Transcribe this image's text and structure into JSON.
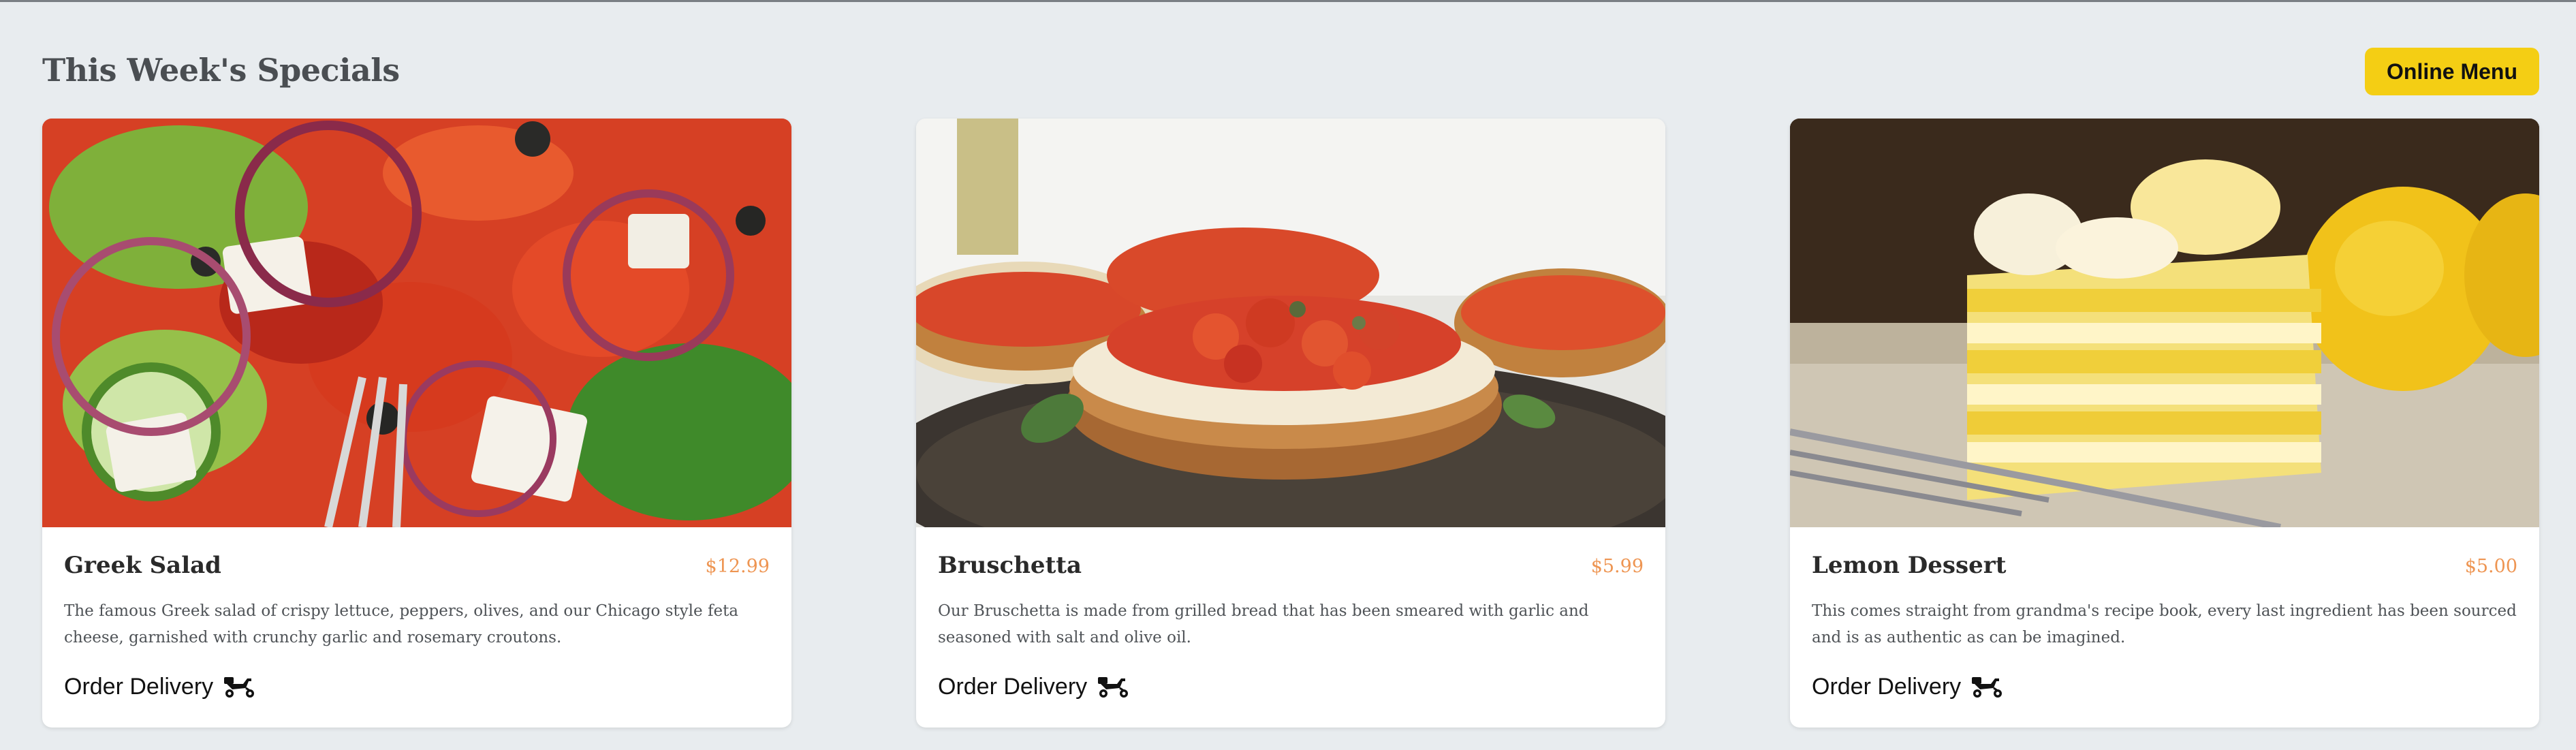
{
  "header": {
    "title": "This Week's Specials",
    "menu_button": "Online Menu"
  },
  "colors": {
    "background": "#e8ecef",
    "accent": "#f4ce14",
    "price": "#ee9552"
  },
  "cards": [
    {
      "name": "Greek Salad",
      "price": "$12.99",
      "description": "The famous Greek salad of crispy lettuce, peppers, olives, and our Chicago style feta cheese, garnished with crunchy garlic and rosemary croutons.",
      "order_label": "Order Delivery",
      "order_icon": "delivery-scooter-icon"
    },
    {
      "name": "Bruschetta",
      "price": "$5.99",
      "description": "Our Bruschetta is made from grilled bread that has been smeared with garlic and seasoned with salt and olive oil.",
      "order_label": "Order Delivery",
      "order_icon": "delivery-scooter-icon"
    },
    {
      "name": "Lemon Dessert",
      "price": "$5.00",
      "description": "This comes straight from grandma's recipe book, every last ingredient has been sourced and is as authentic as can be imagined.",
      "order_label": "Order Delivery",
      "order_icon": "delivery-scooter-icon"
    }
  ]
}
